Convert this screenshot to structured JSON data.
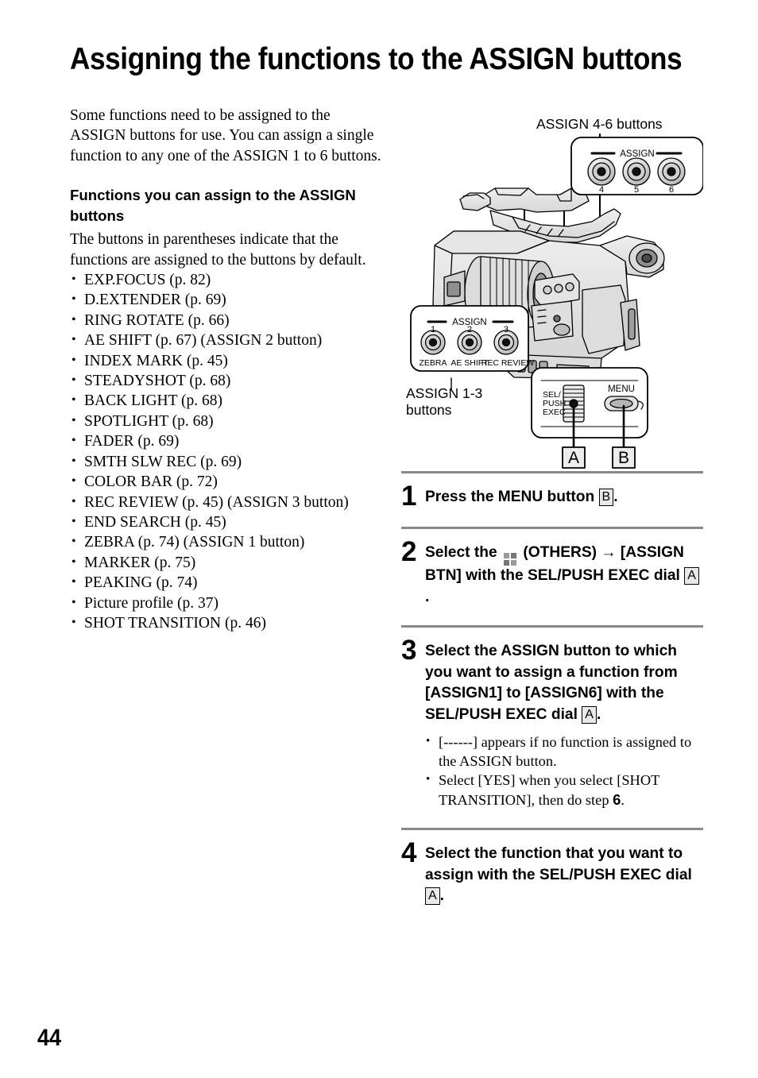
{
  "page": {
    "title": "Assigning the functions to the ASSIGN buttons",
    "number": "44"
  },
  "left_column": {
    "intro": "Some functions need to be assigned to the ASSIGN buttons for use. You can assign a single function to any one of the ASSIGN 1 to 6 buttons.",
    "sub_heading": "Functions you can assign to the ASSIGN buttons",
    "sub_intro": "The buttons in parentheses indicate that the functions are assigned to the buttons by default.",
    "functions": [
      "EXP.FOCUS (p. 82)",
      "D.EXTENDER (p. 69)",
      "RING ROTATE (p. 66)",
      "AE SHIFT (p. 67) (ASSIGN 2 button)",
      "INDEX MARK (p. 45)",
      "STEADYSHOT (p. 68)",
      "BACK LIGHT (p. 68)",
      "SPOTLIGHT (p. 68)",
      "FADER (p. 69)",
      "SMTH SLW REC (p. 69)",
      "COLOR BAR (p. 72)",
      "REC REVIEW (p. 45) (ASSIGN 3 button)",
      "END SEARCH (p. 45)",
      "ZEBRA (p. 74) (ASSIGN 1 button)",
      "MARKER (p. 75)",
      "PEAKING (p. 74)",
      "Picture profile (p. 37)",
      "SHOT TRANSITION (p. 46)"
    ]
  },
  "figure": {
    "caption_top": "ASSIGN 4-6 buttons",
    "caption_left": "ASSIGN 1-3\nbuttons",
    "assign_46_panel": {
      "group_label": "ASSIGN",
      "buttons": [
        "4",
        "5",
        "6"
      ]
    },
    "assign_13_panel": {
      "group_label": "ASSIGN",
      "numbers": [
        "1",
        "2",
        "3"
      ],
      "labels": [
        "ZEBRA",
        "AE SHIFT",
        "REC REVIEW"
      ]
    },
    "dial_panel": {
      "dial_label": "SEL/\nPUSH\nEXEC",
      "menu_label": "MENU",
      "callout_a": "A",
      "callout_b": "B"
    }
  },
  "steps": [
    {
      "number": "1",
      "text_before": "Press the MENU button ",
      "key": "B",
      "text_after": "."
    },
    {
      "number": "2",
      "part1": "Select the ",
      "part2": " (OTHERS) ",
      "arrow": "→",
      "part3": "[ASSIGN BTN] with the SEL/PUSH EXEC dial ",
      "key": "A",
      "part4": "."
    },
    {
      "number": "3",
      "text_before": "Select the ASSIGN button to which you want to assign a function from [ASSIGN1] to [ASSIGN6] with the SEL/PUSH EXEC dial ",
      "key": "A",
      "text_after": ".",
      "notes": [
        {
          "pre": "[------] appears if no function is assigned to the ASSIGN button.",
          "bold": "",
          "post": ""
        },
        {
          "pre": "Select [YES] when you select [SHOT TRANSITION], then do step ",
          "bold": "6",
          "post": "."
        }
      ]
    },
    {
      "number": "4",
      "text_before": "Select the function that you want to assign with the SEL/PUSH EXEC dial ",
      "key": "A",
      "text_after": "."
    }
  ]
}
